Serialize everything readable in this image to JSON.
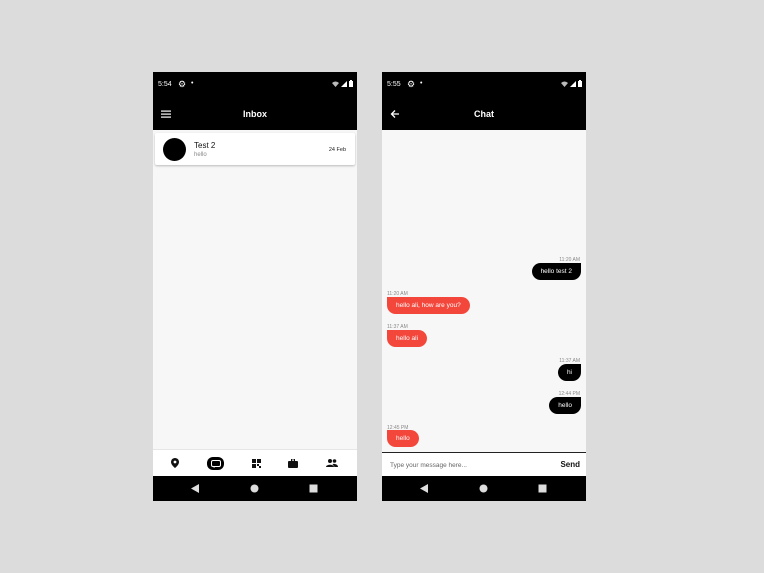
{
  "left_phone": {
    "status_time": "5:54",
    "title": "Inbox",
    "conversation": {
      "name": "Test 2",
      "preview": "hello",
      "date": "24 Feb"
    },
    "bottom_nav": [
      "location-pin-icon",
      "chat-bubble-icon",
      "qr-code-icon",
      "briefcase-icon",
      "people-icon"
    ],
    "active_nav": "chat-bubble-icon"
  },
  "right_phone": {
    "status_time": "5:55",
    "title": "Chat",
    "messages": [
      {
        "time": "11:20 AM",
        "text": "hello test 2",
        "direction": "outgoing"
      },
      {
        "time": "11:20 AM",
        "text": "hello ali, how are you?",
        "direction": "incoming"
      },
      {
        "time": "11:37 AM",
        "text": "hello ali",
        "direction": "incoming"
      },
      {
        "time": "11:37 AM",
        "text": "hi",
        "direction": "outgoing"
      },
      {
        "time": "12:44 PM",
        "text": "hello",
        "direction": "outgoing"
      },
      {
        "time": "12:45 PM",
        "text": "hello",
        "direction": "incoming"
      }
    ],
    "composer": {
      "placeholder": "Type your message here...",
      "value": "",
      "send_label": "Send"
    }
  },
  "colors": {
    "app_bar": "#000000",
    "incoming_bubble": "#f4473c",
    "outgoing_bubble": "#000000",
    "screen_background": "#f7f7f7",
    "page_background": "#dcdcdc"
  }
}
